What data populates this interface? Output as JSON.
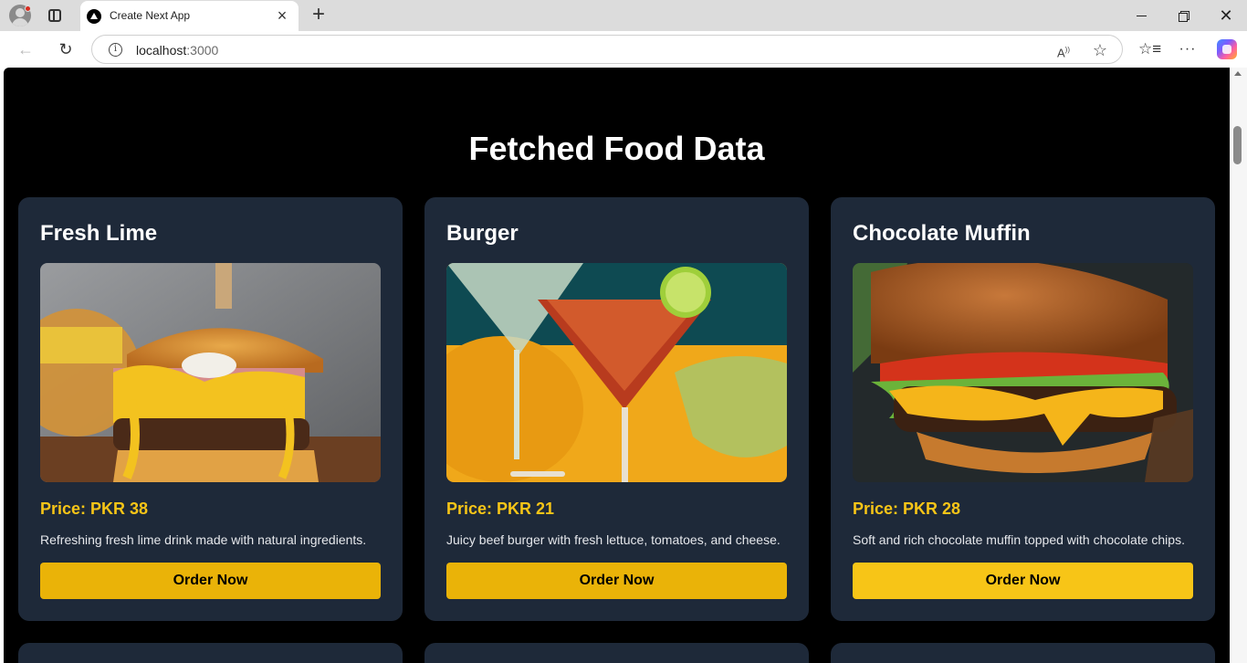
{
  "browser": {
    "tab_title": "Create Next App",
    "url_host": "localhost",
    "url_port": ":3000",
    "icons": {
      "profile": "profile-avatar-icon",
      "tab_actions": "tab-actions-icon",
      "close_tab": "close-icon",
      "new_tab": "plus-icon",
      "back": "back-arrow-icon",
      "reload": "reload-icon",
      "site_info": "info-icon",
      "read_aloud": "read-aloud-icon",
      "favorite": "star-icon",
      "favorites_list": "favorites-icon",
      "more": "more-dots-icon",
      "copilot": "copilot-icon"
    }
  },
  "page": {
    "title": "Fetched Food Data",
    "background": "#000000",
    "card_color": "#1e2939",
    "accent": "#eab308",
    "price_color": "#f7c517"
  },
  "items": [
    {
      "name": "Fresh Lime",
      "price_label": "Price: PKR 38",
      "description": "Refreshing fresh lime drink made with natural ingredients.",
      "button": "Order Now",
      "image": "burger-with-egg-photo"
    },
    {
      "name": "Burger",
      "price_label": "Price: PKR 21",
      "description": "Juicy beef burger with fresh lettuce, tomatoes, and cheese.",
      "button": "Order Now",
      "image": "cocktail-glasses-photo"
    },
    {
      "name": "Chocolate Muffin",
      "price_label": "Price: PKR 28",
      "description": "Soft and rich chocolate muffin topped with chocolate chips.",
      "button": "Order Now",
      "image": "cheeseburger-photo"
    }
  ]
}
